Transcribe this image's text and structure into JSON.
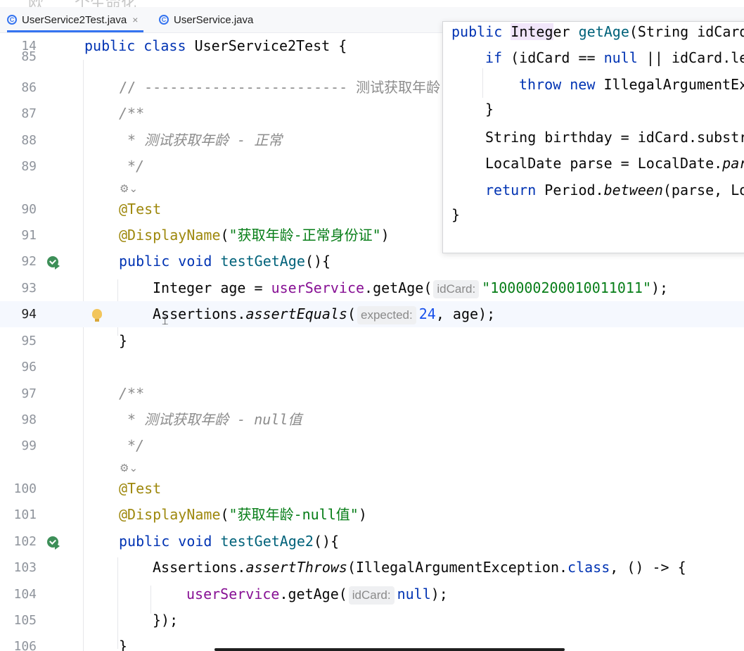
{
  "tabs": [
    {
      "label": "UserService2Test.java",
      "active": true,
      "close": "×"
    },
    {
      "label": "UserService.java",
      "active": false
    }
  ],
  "topstrip_text": [
    "欧",
    "个生命化"
  ],
  "editor": {
    "lines": [
      {
        "num": "14"
      },
      {
        "num": "85"
      },
      {
        "num": "86"
      },
      {
        "num": "87"
      },
      {
        "num": "88"
      },
      {
        "num": "89"
      },
      {
        "num": "90"
      },
      {
        "num": "91"
      },
      {
        "num": "92"
      },
      {
        "num": "93"
      },
      {
        "num": "94"
      },
      {
        "num": "95"
      },
      {
        "num": "96"
      },
      {
        "num": "97"
      },
      {
        "num": "98"
      },
      {
        "num": "99"
      },
      {
        "num": "100"
      },
      {
        "num": "101"
      },
      {
        "num": "102"
      },
      {
        "num": "103"
      },
      {
        "num": "104"
      },
      {
        "num": "105"
      },
      {
        "num": "106"
      }
    ],
    "code": {
      "l14": {
        "kw1": "public",
        "kw2": "class",
        "name": "UserService2Test",
        "brace": "{"
      },
      "l86": "// ------------------------ 测试获取年龄",
      "l87": "/**",
      "l88": "* 测试获取年龄 - 正常",
      "l89": "*/",
      "l90": "@Test",
      "l91": {
        "ann": "@DisplayName",
        "open": "(",
        "str": "\"获取年龄-正常身份证\"",
        "close": ")"
      },
      "l92": {
        "kw1": "public",
        "kw2": "void",
        "fn": "testGetAge",
        "rest": "(){"
      },
      "l93": {
        "type": "Integer age = ",
        "field": "userService",
        "call": ".getAge(",
        "hint": "idCard:",
        "str": "\"100000200010011011\"",
        "end": ");"
      },
      "l94": {
        "cls": "Assertions.",
        "method": "assertEquals",
        "open": "(",
        "hint": "expected:",
        "num": "24",
        "end": ", age);"
      },
      "l95": "}",
      "l97": "/**",
      "l98": "* 测试获取年龄 - null值",
      "l99": "*/",
      "l100": "@Test",
      "l101": {
        "ann": "@DisplayName",
        "open": "(",
        "str": "\"获取年龄-null值\"",
        "close": ")"
      },
      "l102": {
        "kw1": "public",
        "kw2": "void",
        "fn": "testGetAge2",
        "rest": "(){"
      },
      "l103": {
        "cls": "Assertions.",
        "method": "assertThrows",
        "open": "(IllegalArgumentException.",
        "kwclass": "class",
        "end": ", () -> {"
      },
      "l104": {
        "field": "userService",
        "call": ".getAge(",
        "hint": "idCard:",
        "kwnull": "null",
        "end": ");"
      },
      "l105": "});",
      "l106": "}"
    }
  },
  "popup": {
    "l1": {
      "kw": "public",
      "t1": "Inte",
      "t1h": "g",
      "t2": "er ",
      "fn": "getAge",
      "t3": "(String idCard"
    },
    "l2": {
      "kw": "if",
      "t1": "(idCard == ",
      "kwnull": "null",
      "t2": "||",
      "t3": " idCard.le"
    },
    "l3": {
      "kw1": "throw",
      "kw2": "new",
      "t1": "IllegalArgumentEx"
    },
    "l4": "}",
    "l5": "String birthday = idCard.substr",
    "l6": {
      "t1": "LocalDate parse = LocalDate.",
      "it": "par"
    },
    "l7": {
      "kw": "return",
      "t1": "Period.",
      "it": "between",
      "t2": "(parse, Lo"
    },
    "l8": "}"
  }
}
